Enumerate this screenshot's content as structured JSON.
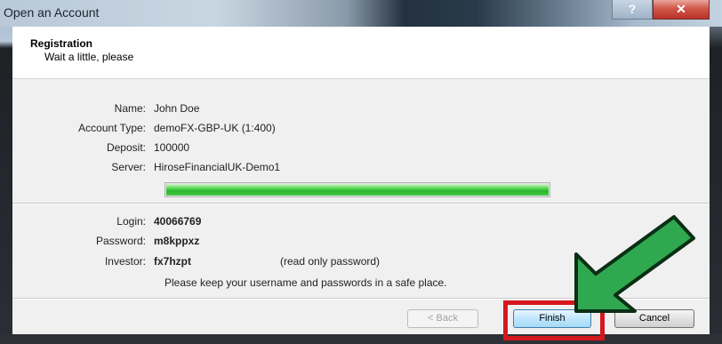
{
  "window": {
    "title": "Open an Account",
    "help_glyph": "?",
    "close_glyph": "✕"
  },
  "header": {
    "title": "Registration",
    "subtitle": "Wait a little, please"
  },
  "account": {
    "name_label": "Name:",
    "name_value": "John Doe",
    "type_label": "Account Type:",
    "type_value": "demoFX-GBP-UK (1:400)",
    "deposit_label": "Deposit:",
    "deposit_value": "100000",
    "server_label": "Server:",
    "server_value": "HiroseFinancialUK-Demo1"
  },
  "progress": {
    "percent": 100
  },
  "credentials": {
    "login_label": "Login:",
    "login_value": "40066769",
    "password_label": "Password:",
    "password_value": "m8kppxz",
    "investor_label": "Investor:",
    "investor_value": "fx7hzpt",
    "investor_note": "(read only password)",
    "notice": "Please keep your username and passwords in a safe place."
  },
  "buttons": {
    "back_label": "< Back",
    "finish_label": "Finish",
    "cancel_label": "Cancel"
  },
  "colors": {
    "highlight": "#d5171f",
    "arrow_fill": "#2fa84f",
    "arrow_outline": "#0a2f14",
    "progress": "#2bb62b"
  }
}
